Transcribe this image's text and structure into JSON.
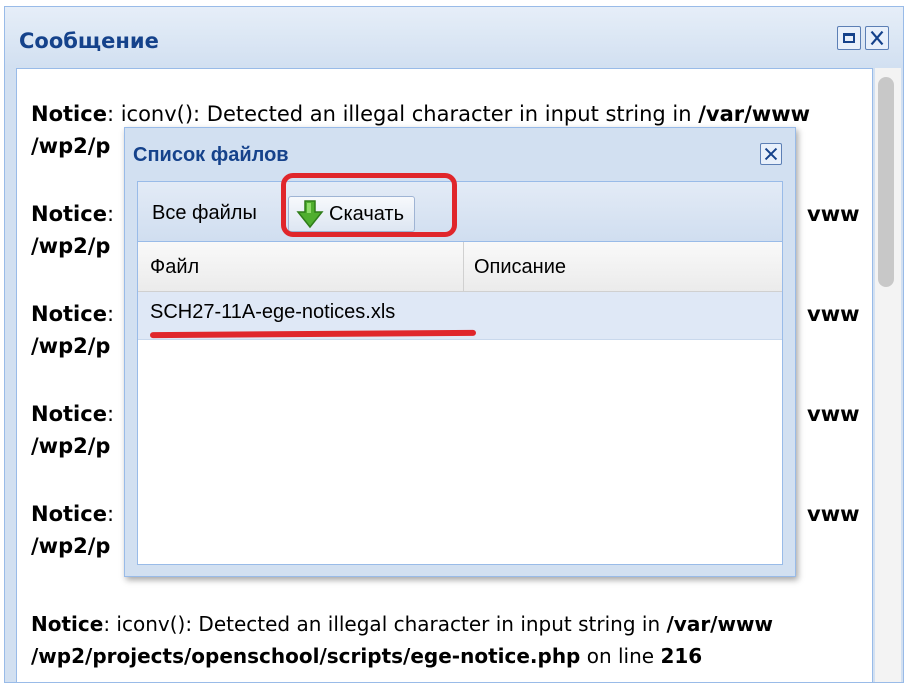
{
  "outer_window": {
    "title": "Сообщение",
    "maximize_label": "",
    "close_label": ""
  },
  "notices": [
    {
      "prefix": "Notice",
      "text": ": iconv(): Detected an illegal character in input string in ",
      "path1": "/var/www",
      "path2": "/wp2/p"
    },
    {
      "prefix": "Notice",
      "text": ":",
      "path1": "vww",
      "path2": "/wp2/p"
    },
    {
      "prefix": "Notice",
      "text": ":",
      "path1": "vww",
      "path2": "/wp2/p"
    },
    {
      "prefix": "Notice",
      "text": ":",
      "path1": "vww",
      "path2": "/wp2/p"
    },
    {
      "prefix": "Notice",
      "text": ":",
      "path1": "vww",
      "path2": "/wp2/p"
    }
  ],
  "last_notice": {
    "prefix": "Notice",
    "text": ": iconv(): Detected an illegal character in input string in ",
    "path1": "/var/www",
    "path2": "/wp2/projects/openschool/scripts/ege-notice.php",
    "on_line": " on line ",
    "line": "216"
  },
  "dialog": {
    "title": "Список файлов",
    "toolbar": {
      "all_files": "Все файлы",
      "download": "Скачать"
    },
    "columns": [
      "Файл",
      "Описание"
    ],
    "rows": [
      {
        "file": "SCH27-11A-ege-notices.xls",
        "description": ""
      }
    ]
  },
  "colors": {
    "header_text": "#15428b",
    "annotation_red": "#e0262b",
    "download_arrow": "#4fae2e"
  },
  "icons": {
    "maximize": "maximize-icon",
    "close": "close-icon",
    "download": "download-arrow-icon"
  }
}
